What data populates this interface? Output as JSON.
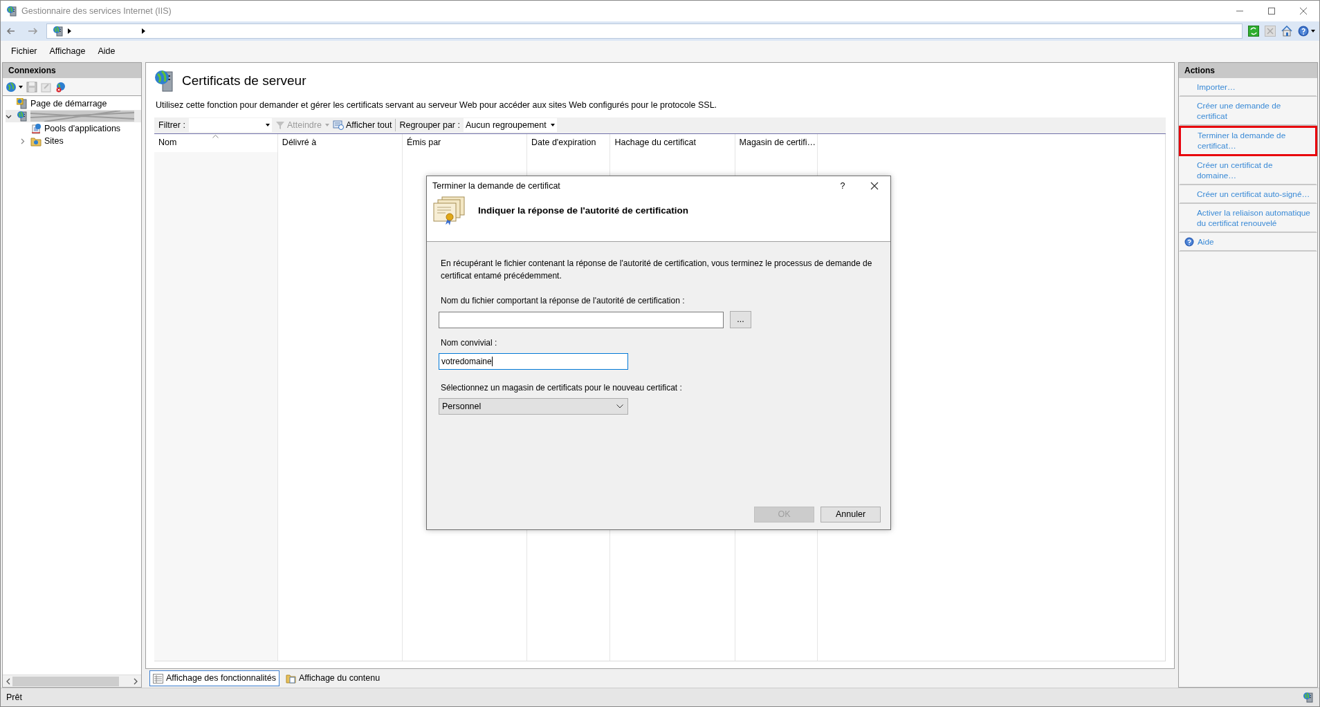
{
  "window": {
    "title": "Gestionnaire des services Internet (IIS)"
  },
  "menu": [
    "Fichier",
    "Affichage",
    "Aide"
  ],
  "connections": {
    "title": "Connexions",
    "tree": [
      {
        "kind": "start",
        "label": "Page de démarrage"
      },
      {
        "kind": "server",
        "expanded": true,
        "children": [
          {
            "kind": "pools",
            "label": "Pools d'applications"
          },
          {
            "kind": "sites",
            "label": "Sites",
            "expanded": false
          }
        ]
      }
    ]
  },
  "page": {
    "title": "Certificats de serveur",
    "description": "Utilisez cette fonction pour demander et gérer les certificats servant au serveur Web pour accéder aux sites Web configurés pour le protocole SSL.",
    "filter": {
      "label": "Filtrer :",
      "go": "Atteindre",
      "go_disabled": true,
      "show_all": "Afficher tout",
      "group_label": "Regrouper par :",
      "group_value": "Aucun regroupement"
    },
    "columns": [
      {
        "label": "Nom",
        "sorted": true
      },
      {
        "label": "Délivré à",
        "sorted": false
      },
      {
        "label": "Émis par",
        "sorted": false
      },
      {
        "label": "Date d'expiration",
        "sorted": false
      },
      {
        "label": "Hachage du certificat",
        "sorted": false
      },
      {
        "label": "Magasin de certifi…",
        "sorted": false
      }
    ]
  },
  "view_tabs": [
    {
      "label": "Affichage des fonctionnalités",
      "selected": true
    },
    {
      "label": "Affichage du contenu",
      "selected": false
    }
  ],
  "actions": {
    "title": "Actions",
    "items": [
      {
        "kind": "link",
        "label": "Importer…",
        "highlighted": false
      },
      {
        "kind": "link",
        "label": "Créer une demande de certificat",
        "highlighted": false
      },
      {
        "kind": "link",
        "label": "Terminer la demande de certificat…",
        "highlighted": true
      },
      {
        "kind": "link",
        "label": "Créer un certificat de domaine…",
        "highlighted": false
      },
      {
        "kind": "link",
        "label": "Créer un certificat auto-signé…",
        "highlighted": false
      },
      {
        "kind": "link",
        "label": "Activer la reliaison automatique du certificat renouvelé",
        "highlighted": false
      },
      {
        "kind": "help",
        "label": "Aide",
        "highlighted": false
      }
    ]
  },
  "dialog": {
    "title": "Terminer la demande de certificat",
    "help": "?",
    "heading": "Indiquer la réponse de l'autorité de certification",
    "intro": "En récupérant le fichier contenant la réponse de l'autorité de certification, vous terminez le processus de demande de certificat entamé précédemment.",
    "file_label": "Nom du fichier comportant la réponse de l'autorité de certification :",
    "browse": "...",
    "name_label": "Nom convivial :",
    "name_value": "votredomaine",
    "name_focused": true,
    "store_label": "Sélectionnez un magasin de certificats pour le nouveau certificat :",
    "store_value": "Personnel",
    "buttons": [
      {
        "label": "OK",
        "disabled": true
      },
      {
        "label": "Annuler",
        "disabled": false
      }
    ]
  },
  "status_bar": {
    "text": "Prêt"
  }
}
